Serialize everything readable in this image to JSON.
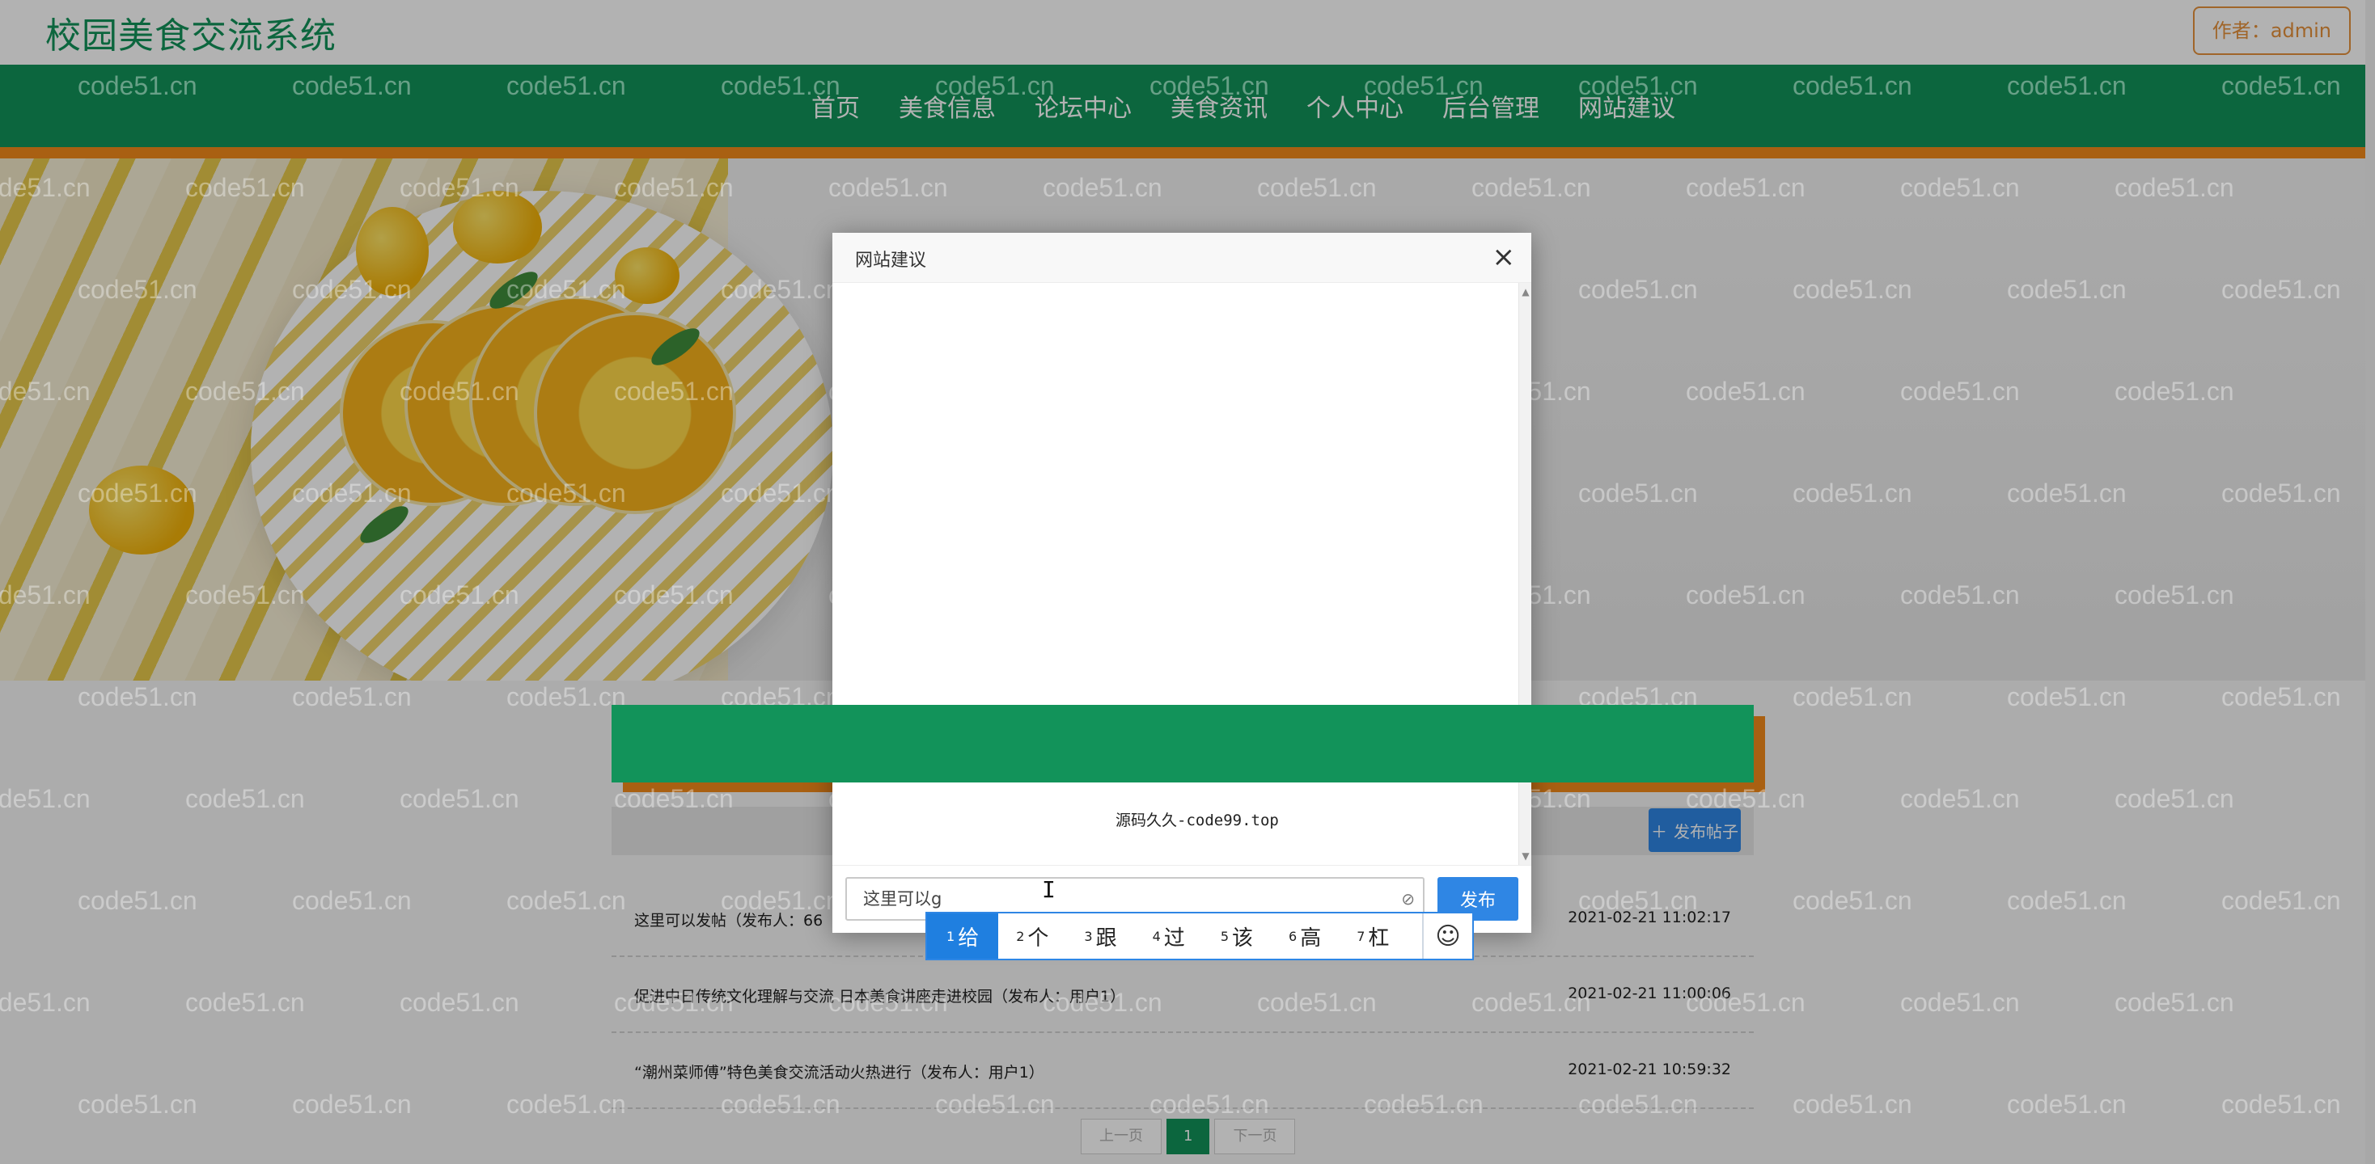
{
  "header": {
    "site_title": "校园美食交流系统",
    "author_label": "作者：admin"
  },
  "nav": {
    "items": [
      "首页",
      "美食信息",
      "论坛中心",
      "美食资讯",
      "个人中心",
      "后台管理",
      "网站建议"
    ]
  },
  "forum": {
    "post_button_label": "发布帖子",
    "posts": [
      {
        "title": "这里可以发帖（发布人：66",
        "time": "2021-02-21 11:02:17"
      },
      {
        "title": "促进中日传统文化理解与交流 日本美食讲座走进校园（发布人：用户1）",
        "time": "2021-02-21 11:00:06"
      },
      {
        "title": "“潮州菜师傅”特色美食交流活动火热进行（发布人：用户1）",
        "time": "2021-02-21 10:59:32"
      }
    ],
    "pager": {
      "prev": "上一页",
      "current": "1",
      "next": "下一页"
    }
  },
  "watermark": "code51.cn",
  "modal": {
    "title": "网站建议",
    "close_glyph": "×",
    "iframe_text": "源码久久-code99.top",
    "input_value": "这里可以g",
    "publish_label": "发布"
  },
  "ime": {
    "candidates": [
      {
        "num": "1",
        "char": "给"
      },
      {
        "num": "2",
        "char": "个"
      },
      {
        "num": "3",
        "char": "跟"
      },
      {
        "num": "4",
        "char": "过"
      },
      {
        "num": "5",
        "char": "该"
      },
      {
        "num": "6",
        "char": "高"
      },
      {
        "num": "7",
        "char": "杠"
      }
    ],
    "emoji_glyph": "☺"
  },
  "colors": {
    "brand_green": "#12935a",
    "accent_orange": "#f28a1a",
    "button_blue": "#2f86e4"
  }
}
